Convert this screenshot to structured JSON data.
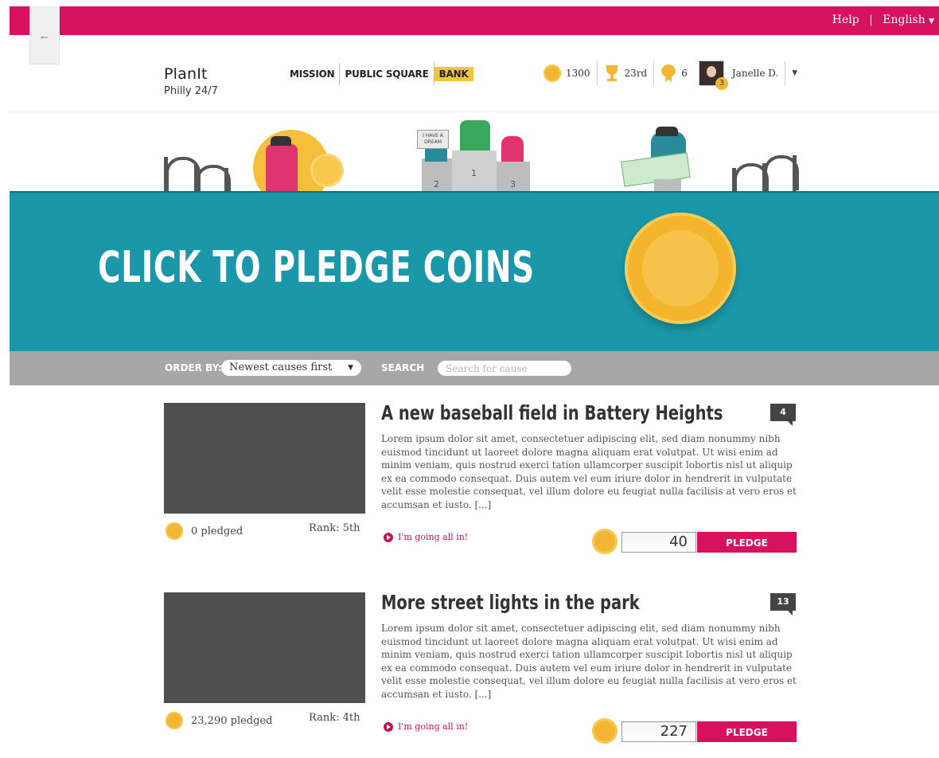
{
  "topbar": {
    "help": "Help",
    "separator": "|",
    "language": "English"
  },
  "header": {
    "brand_name": "PlanIt",
    "brand_sub": "Philly 24/7",
    "nav": [
      {
        "label": "MISSION"
      },
      {
        "label": "PUBLIC SQUARE"
      },
      {
        "label": "BANK",
        "active": true
      }
    ],
    "stats": {
      "coins": "1300",
      "rank": "23rd",
      "badges": "6",
      "avatar_badge": "3",
      "user_name": "Janelle D."
    }
  },
  "illustration": {
    "sign_text": "I HAVE A DREAM",
    "podium": [
      "2",
      "1",
      "3"
    ]
  },
  "banner": {
    "title": "CLICK TO PLEDGE COINS"
  },
  "filters": {
    "order_label": "ORDER BY:",
    "order_value": "Newest causes first",
    "search_label": "SEARCH",
    "search_placeholder": "Search for cause"
  },
  "causes": [
    {
      "title": "A new baseball field in Battery Heights",
      "comments": "4",
      "description": "Lorem ipsum dolor sit amet, consectetuer adipiscing elit, sed diam nonummy nibh euismod tincidunt ut laoreet dolore magna aliquam erat volutpat. Ut wisi enim ad minim veniam, quis nostrud exerci tation ullamcorper suscipit lobortis nisl ut aliquip ex ea commodo consequat. Duis autem vel eum iriure dolor in hendrerit in vulputate velit esse molestie consequat, vel illum dolore eu feugiat nulla facilisis at vero eros et accumsan et iusto. [...]",
      "pledged": "0 pledged",
      "rank": "Rank: 5th",
      "all_in": "I'm going all in!",
      "amount": "40",
      "pledge_label": "PLEDGE"
    },
    {
      "title": "More street lights in the park",
      "comments": "13",
      "description": "Lorem ipsum dolor sit amet, consectetuer adipiscing elit, sed diam nonummy nibh euismod tincidunt ut laoreet dolore magna aliquam erat volutpat. Ut wisi enim ad minim veniam, quis nostrud exerci tation ullamcorper suscipit lobortis nisl ut aliquip ex ea commodo consequat. Duis autem vel eum iriure dolor in hendrerit in vulputate velit esse molestie consequat, vel illum dolore eu feugiat nulla facilisis at vero eros et accumsan et iusto. [...]",
      "pledged": "23,290 pledged",
      "rank": "Rank: 4th",
      "all_in": "I'm going all in!",
      "amount": "227",
      "pledge_label": "PLEDGE"
    }
  ],
  "colors": {
    "brand": "#d6125f",
    "banner": "#1a97a8",
    "coin": "#f3b632",
    "filterbar": "#a7a7a7"
  }
}
